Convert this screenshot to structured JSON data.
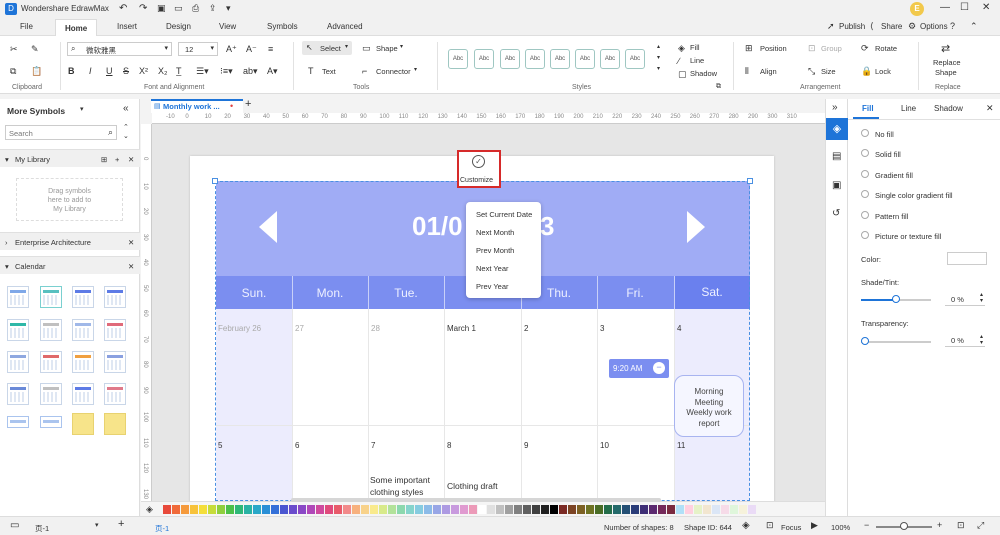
{
  "app": {
    "title": "Wondershare EdrawMax",
    "avatar_letter": "E"
  },
  "menu": {
    "items": [
      "File",
      "Home",
      "Insert",
      "Design",
      "View",
      "Symbols",
      "Advanced"
    ],
    "active": "Home"
  },
  "title_actions": {
    "publish": "Publish",
    "share": "Share",
    "options": "Options"
  },
  "ribbon": {
    "groups": {
      "clipboard": "Clipboard",
      "font_alignment": "Font and Alignment",
      "tools": "Tools",
      "styles": "Styles",
      "arrangement": "Arrangement",
      "replace": "Replace"
    },
    "font_name": "微软雅黑",
    "font_size": "12",
    "select": "Select",
    "shape": "Shape",
    "text": "Text",
    "connector": "Connector",
    "style_sample": "Abc",
    "fill": "Fill",
    "line": "Line",
    "shadow": "Shadow",
    "position": "Position",
    "group": "Group",
    "rotate": "Rotate",
    "align": "Align",
    "size": "Size",
    "lock": "Lock",
    "replace_shape_1": "Replace",
    "replace_shape_2": "Shape"
  },
  "left_panel": {
    "title": "More Symbols",
    "search_placeholder": "Search",
    "my_library": "My Library",
    "drag_hint": [
      "Drag symbols",
      "here to add to",
      "My Library"
    ],
    "enterprise": "Enterprise Architecture",
    "calendar": "Calendar"
  },
  "tab": {
    "name": "Monthly work ..."
  },
  "ruler": {
    "h": [
      "-10",
      "0",
      "10",
      "20",
      "30",
      "40",
      "50",
      "60",
      "70",
      "80",
      "90",
      "100",
      "110",
      "120",
      "130",
      "140",
      "150",
      "160",
      "170",
      "180",
      "190",
      "200",
      "210",
      "220",
      "230",
      "240",
      "250",
      "260",
      "270",
      "280",
      "290",
      "300",
      "310"
    ],
    "v": [
      "0",
      "10",
      "20",
      "30",
      "40",
      "50",
      "60",
      "70",
      "80",
      "90",
      "100",
      "110",
      "120",
      "130"
    ]
  },
  "calendar": {
    "title": "01/0",
    "title_tail": "3",
    "weekdays": [
      "Sun.",
      "Mon.",
      "Tue.",
      "Wed.",
      "Thu.",
      "Fri.",
      "Sat."
    ],
    "row1": [
      "February 26",
      "27",
      "28",
      "March 1",
      "2",
      "3",
      "4"
    ],
    "row2": [
      "5",
      "6",
      "7",
      "8",
      "9",
      "10",
      "11"
    ],
    "event_time": "9:20 AM",
    "callout": [
      "Morning",
      "Meeting",
      "Weekly work",
      "report"
    ],
    "task_tue": [
      "Some important",
      "clothing styles"
    ],
    "task_wed": "Clothing draft"
  },
  "customize": {
    "label": "Customize"
  },
  "context_menu": [
    "Set Current Date",
    "Next Month",
    "Prev Month",
    "Next Year",
    "Prev Year"
  ],
  "right_panel": {
    "tabs": [
      "Fill",
      "Line",
      "Shadow"
    ],
    "options": [
      "No fill",
      "Solid fill",
      "Gradient fill",
      "Single color gradient fill",
      "Pattern fill",
      "Picture or texture fill"
    ],
    "selected_option": "Solid fill",
    "color_label": "Color:",
    "shade_label": "Shade/Tint:",
    "shade_value": "0 %",
    "transparency_label": "Transparency:",
    "transparency_value": "0 %"
  },
  "status": {
    "page_selector": "页-1",
    "page_tab": "页-1",
    "shapes": "Number of shapes: 8",
    "shape_id": "Shape ID: 644",
    "focus": "Focus",
    "zoom": "100%"
  },
  "colors": {
    "accent": "#7b8ef0",
    "header_fill": "#a0acf5",
    "highlight": "#d62a2a",
    "primary_blue": "#1e74d8"
  },
  "palette": [
    "#e84a3b",
    "#f06a3a",
    "#f59a3c",
    "#f7c23a",
    "#f4de3a",
    "#c6dc3a",
    "#8fcf3e",
    "#4cc04a",
    "#2fb877",
    "#2ab3a4",
    "#2aa8c8",
    "#2a8fd6",
    "#3470d8",
    "#4a56d0",
    "#6a4ccc",
    "#8a48c6",
    "#b048b8",
    "#cf4a9e",
    "#e04a7c",
    "#e85a6a",
    "#f28a8a",
    "#f7b17e",
    "#f8d28a",
    "#f9ea8c",
    "#d8ea8a",
    "#b2e29a",
    "#8cd8ae",
    "#86d4cc",
    "#86cce0",
    "#8cbbe8",
    "#98a6e6",
    "#ad9ae2",
    "#c89ade",
    "#e09ad0",
    "#ec9ab8",
    "#ffffff",
    "#e0e0e0",
    "#c0c0c0",
    "#a0a0a0",
    "#808080",
    "#606060",
    "#404040",
    "#202020",
    "#000000",
    "#7b2a24",
    "#7c4424",
    "#7d6124",
    "#6f7324",
    "#4a6d26",
    "#246e4a",
    "#246a6a",
    "#244f74",
    "#2a3c78",
    "#3e2e76",
    "#5c2a70",
    "#74295a",
    "#7a2a40",
    "#b0e0f8",
    "#ffd0e0",
    "#e6f2c8",
    "#f2e6d0",
    "#dbe6f6",
    "#f6dbe8",
    "#dff6db",
    "#f6f2db",
    "#eadbf6"
  ]
}
